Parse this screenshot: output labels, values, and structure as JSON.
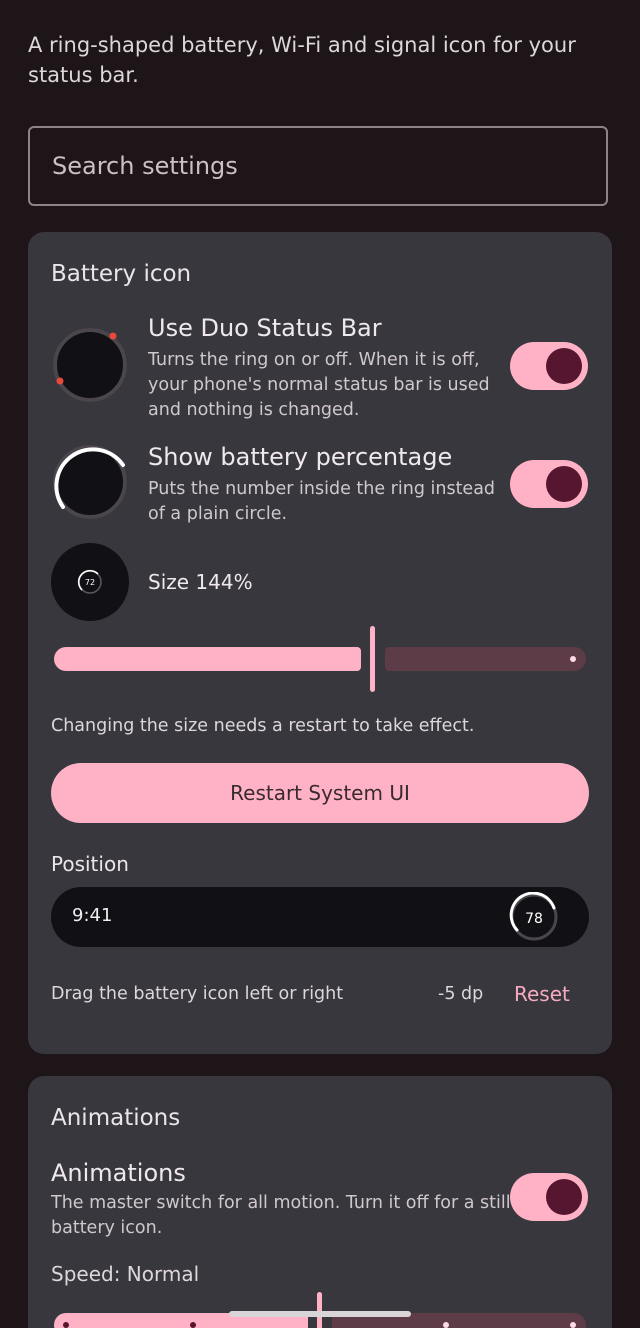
{
  "description": "A ring-shaped battery, Wi-Fi and signal icon for your status bar.",
  "search": {
    "placeholder": "Search settings"
  },
  "battery_card": {
    "title": "Battery icon",
    "use_duo": {
      "title": "Use Duo Status Bar",
      "subtitle": "Turns the ring on or off. When it is off, your phone's normal status bar is used and nothing is changed.",
      "enabled": true,
      "icon": "ring-preview-icon"
    },
    "show_percentage": {
      "title": "Show battery percentage",
      "subtitle": "Puts the number inside the ring instead of a plain circle.",
      "enabled": true,
      "icon": "ring-progress-icon"
    },
    "size": {
      "label": "Size 144%",
      "icon_number": "72",
      "slider_fraction": 0.58
    },
    "restart_note": "Changing the size needs a restart to take effect.",
    "restart_button": "Restart System UI",
    "position": {
      "label": "Position",
      "preview_time": "9:41",
      "preview_battery": "78",
      "drag_hint": "Drag the battery icon left or right",
      "offset_value": "-5 dp",
      "reset_label": "Reset"
    }
  },
  "animations_card": {
    "title": "Animations",
    "master": {
      "title": "Animations",
      "subtitle": "The master switch for all motion. Turn it off for a still battery icon.",
      "enabled": true
    },
    "speed": {
      "label": "Speed: Normal",
      "slider_fraction": 0.5
    }
  },
  "colors": {
    "background": "#1d1518",
    "card": "#38373e",
    "accent": "#ffb2c5",
    "accent_dark": "#561630",
    "track_inactive": "#5e3c47",
    "ring_red": "#e8473c"
  }
}
